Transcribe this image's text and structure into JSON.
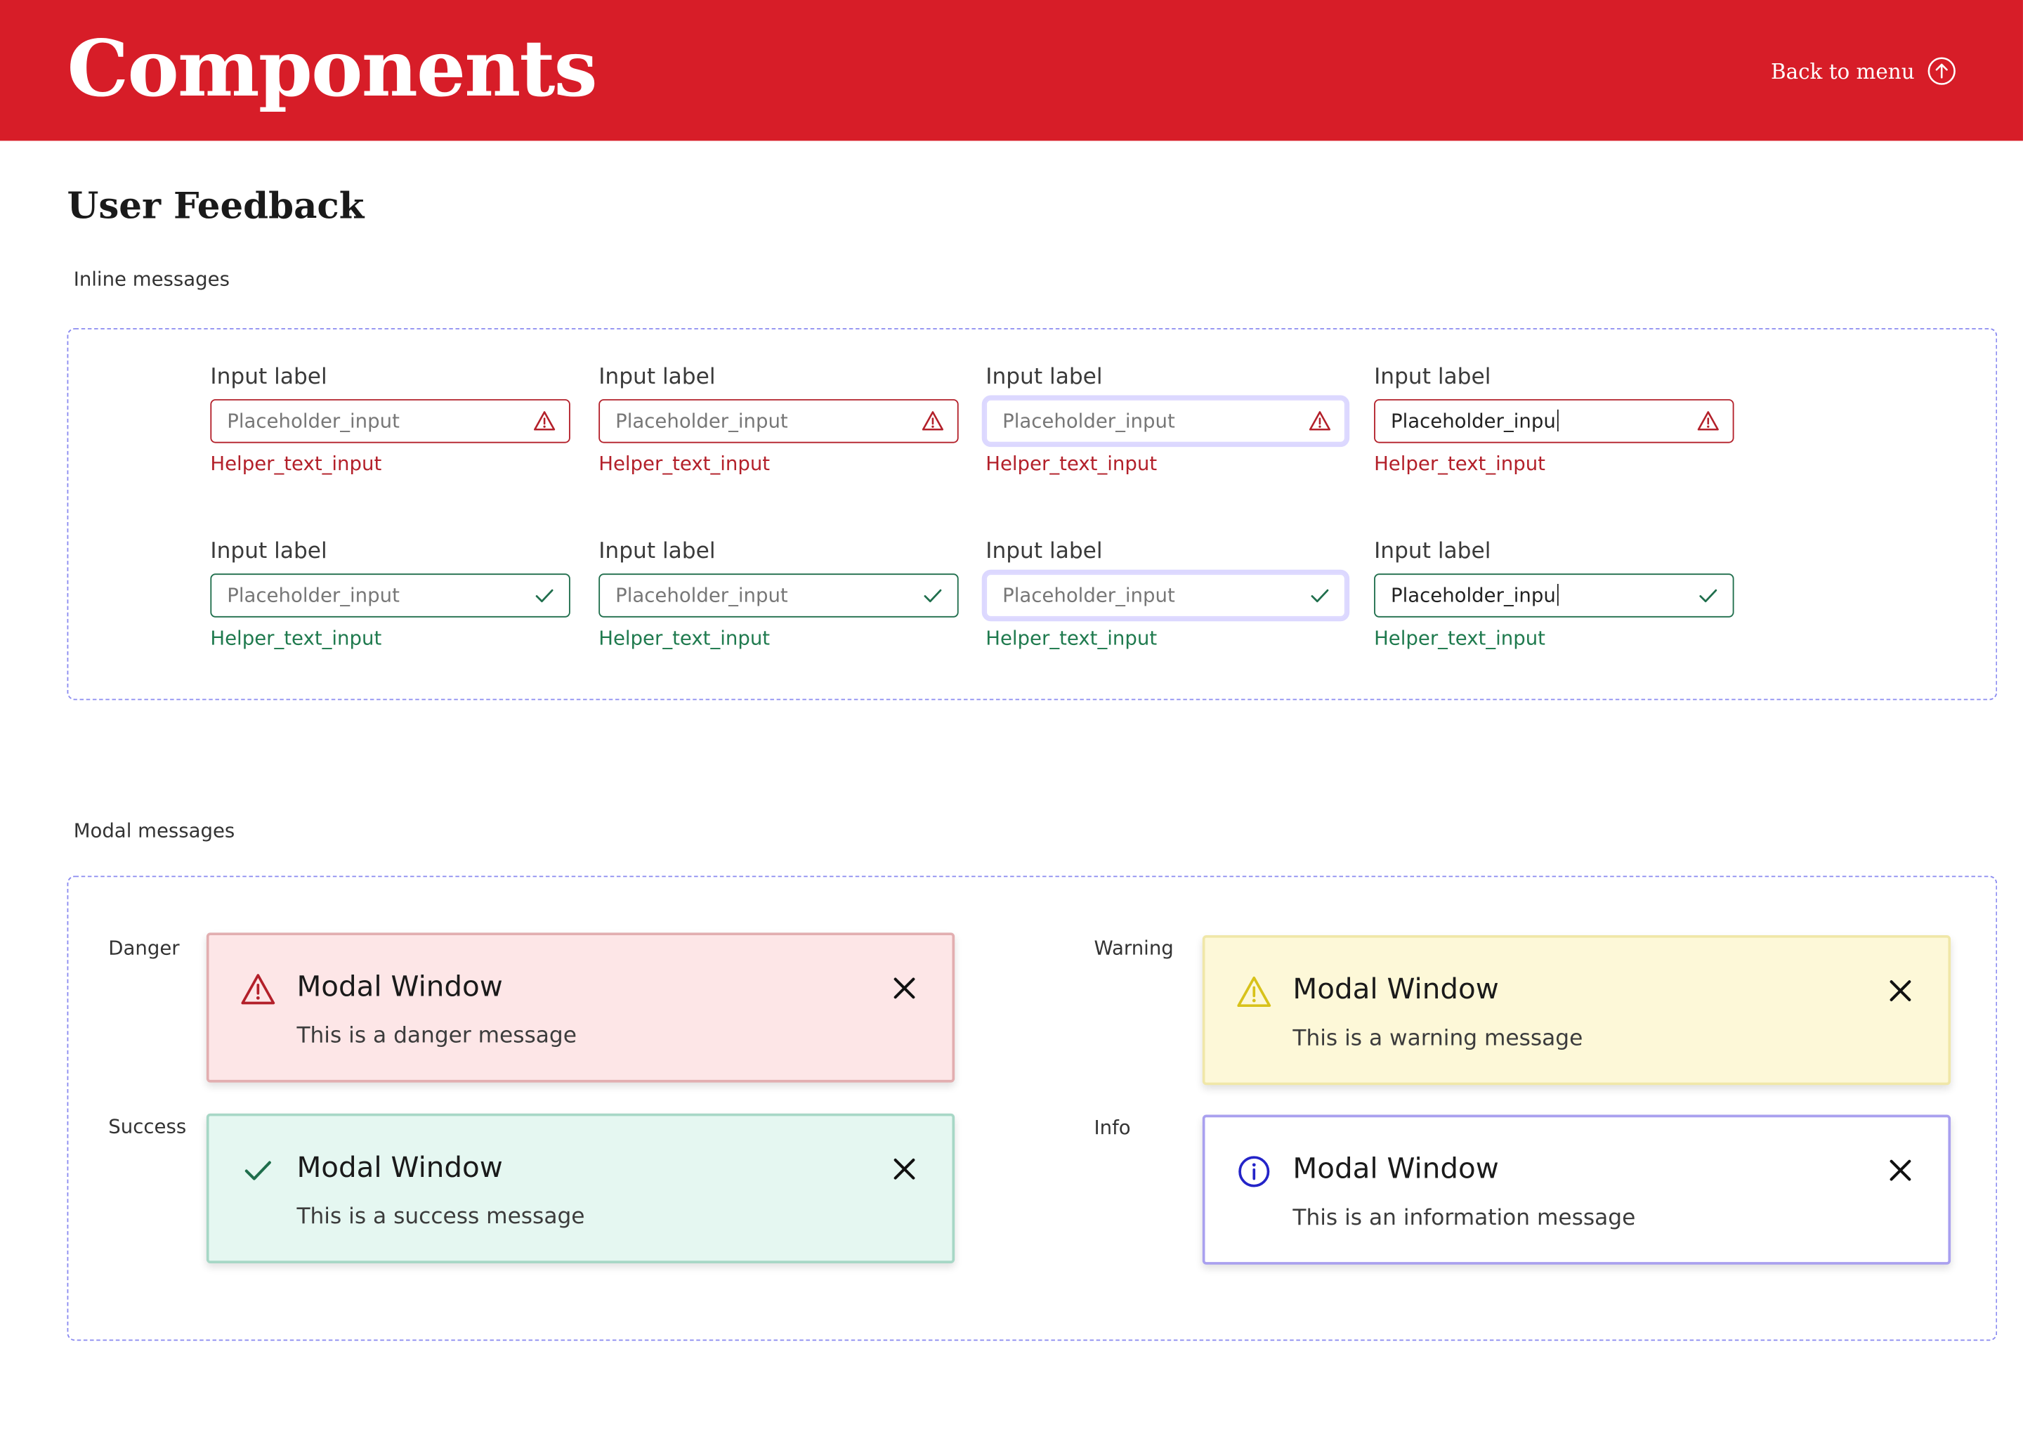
{
  "header": {
    "title": "Components",
    "back_label": "Back to menu"
  },
  "section_title": "User Feedback",
  "inline": {
    "heading": "Inline messages",
    "error_row": [
      {
        "label": "Input label",
        "placeholder": "Placeholder_input",
        "value": "",
        "helper": "Helper_text_input"
      },
      {
        "label": "Input label",
        "placeholder": "Placeholder_input",
        "value": "",
        "helper": "Helper_text_input"
      },
      {
        "label": "Input label",
        "placeholder": "Placeholder_input",
        "value": "",
        "helper": "Helper_text_input"
      },
      {
        "label": "Input label",
        "placeholder": "",
        "value": "Placeholder_inpu",
        "helper": "Helper_text_input"
      }
    ],
    "success_row": [
      {
        "label": "Input label",
        "placeholder": "Placeholder_input",
        "value": "",
        "helper": "Helper_text_input"
      },
      {
        "label": "Input label",
        "placeholder": "Placeholder_input",
        "value": "",
        "helper": "Helper_text_input"
      },
      {
        "label": "Input label",
        "placeholder": "Placeholder_input",
        "value": "",
        "helper": "Helper_text_input"
      },
      {
        "label": "Input label",
        "placeholder": "",
        "value": "Placeholder_inpu",
        "helper": "Helper_text_input"
      }
    ]
  },
  "modal": {
    "heading": "Modal messages",
    "danger": {
      "tag": "Danger",
      "title": "Modal Window",
      "message": "This is a danger message",
      "icon": "warning-triangle-icon"
    },
    "warning": {
      "tag": "Warning",
      "title": "Modal Window",
      "message": "This is a warning message",
      "icon": "warning-triangle-icon"
    },
    "success": {
      "tag": "Success",
      "title": "Modal Window",
      "message": "This is a success message",
      "icon": "checkmark-icon"
    },
    "info": {
      "tag": "Info",
      "title": "Modal Window",
      "message": "This is an information message",
      "icon": "info-circle-icon"
    }
  },
  "colors": {
    "brand_red": "#d71d28",
    "error": "#b3202a",
    "success": "#1f6e4c",
    "warning_icon": "#d8c21a",
    "info_icon": "#2424c8",
    "dashed_border": "#8b8bf0",
    "focus_ring": "#dcd8ff"
  }
}
